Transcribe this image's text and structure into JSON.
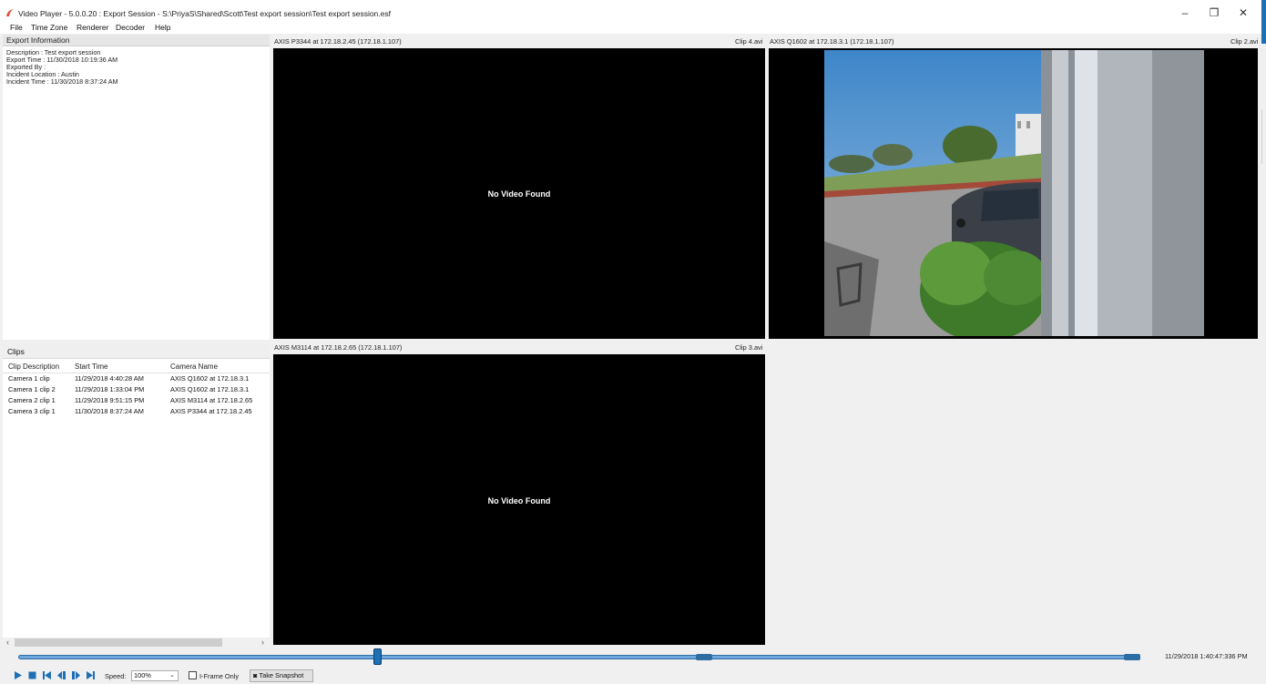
{
  "window": {
    "title": "Video Player - 5.0.0.20 : Export Session - S:\\PriyaS\\Shared\\Scott\\Test export session\\Test export session.esf",
    "minimize": "–",
    "restore": "❐",
    "close": "✕"
  },
  "menu": [
    "File",
    "Time Zone",
    "Renderer",
    "Decoder",
    "Help"
  ],
  "export_info": {
    "header": "Export Information",
    "lines": [
      "Description : Test export session",
      "Export Time : 11/30/2018 10:19:36 AM",
      "Exported By :",
      "Incident Location : Austin",
      "Incident Time : 11/30/2018 8:37:24 AM"
    ]
  },
  "clips": {
    "header": "Clips",
    "columns": [
      "Clip Description",
      "Start Time",
      "Camera Name"
    ],
    "rows": [
      [
        "Camera 1 clip",
        "11/29/2018 4:40:28 AM",
        "AXIS Q1602 at 172.18.3.1"
      ],
      [
        "Camera 1 clip 2",
        "11/29/2018 1:33:04 PM",
        "AXIS Q1602 at 172.18.3.1"
      ],
      [
        "Camera 2 clip 1",
        "11/29/2018 9:51:15 PM",
        "AXIS M3114 at 172.18.2.65"
      ],
      [
        "Camera 3 clip 1",
        "11/30/2018 8:37:24 AM",
        "AXIS P3344 at 172.18.2.45"
      ]
    ]
  },
  "video_panes": [
    {
      "camera": "AXIS P3344 at 172.18.2.45 (172.18.1.107)",
      "clip": "Clip 4.avi",
      "message": "No Video Found"
    },
    {
      "camera": "AXIS Q1602 at 172.18.3.1 (172.18.1.107)",
      "clip": "Clip 2.avi",
      "message": ""
    },
    {
      "camera": "AXIS M3114 at 172.18.2.65 (172.18.1.107)",
      "clip": "Clip 3.avi",
      "message": "No Video Found"
    }
  ],
  "playback": {
    "timestamp": "11/29/2018 1:40:47:336 PM",
    "speed_label": "Speed:",
    "speed_value": "100%",
    "iframe_label": "I-Frame Only",
    "snapshot_label": "Take Snapshot",
    "position_fraction": 0.32
  },
  "icons": [
    "app-icon",
    "play-icon",
    "stop-icon",
    "skip-start-icon",
    "step-back-icon",
    "step-forward-icon",
    "skip-end-icon",
    "camera-icon"
  ],
  "colors": {
    "accent": "#1f6fb5",
    "video_bg": "#000000"
  }
}
